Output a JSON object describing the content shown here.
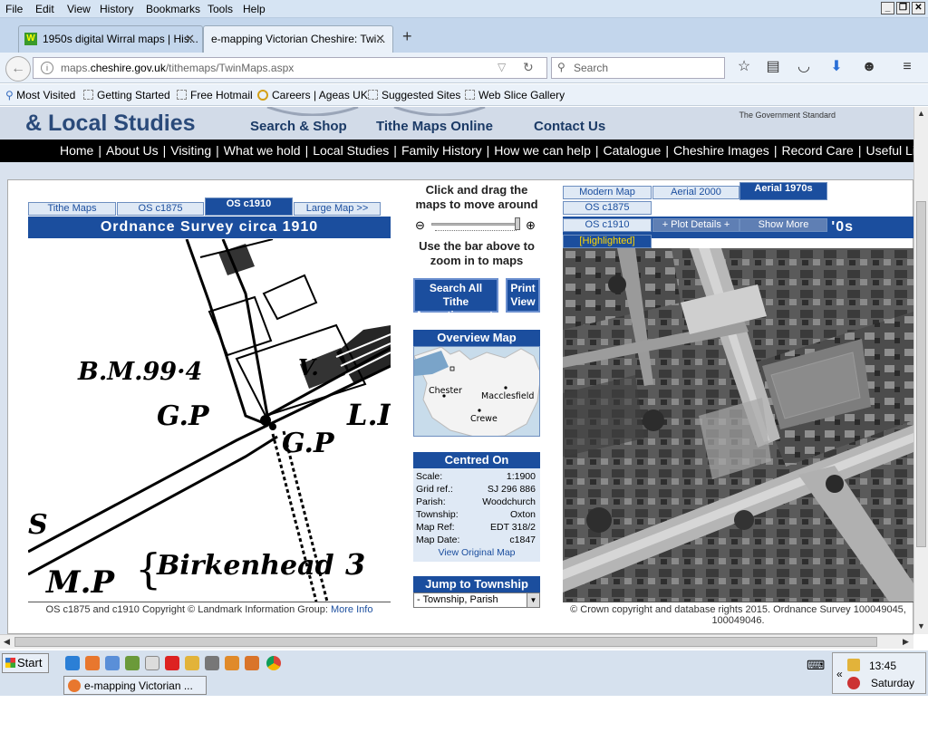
{
  "menu": [
    "File",
    "Edit",
    "View",
    "History",
    "Bookmarks",
    "Tools",
    "Help"
  ],
  "tabs": [
    {
      "label": "1950s digital Wirral maps | His..."
    },
    {
      "label": "e-mapping Victorian Cheshire: Twi..."
    }
  ],
  "url": {
    "prefix": "maps.",
    "domain": "cheshire.gov.uk",
    "path": "/tithemaps/TwinMaps.aspx"
  },
  "search_placeholder": "Search",
  "bookmarks": [
    "Most Visited",
    "Getting Started",
    "Free Hotmail",
    "Careers | Ageas UK",
    "Suggested Sites",
    "Web Slice Gallery"
  ],
  "site": {
    "title": "& Local Studies",
    "header_links": [
      "Search & Shop",
      "Tithe Maps Online",
      "Contact Us"
    ],
    "gov_standard": "The Government Standard",
    "nav": [
      "Home",
      "About Us",
      "Visiting",
      "What we hold",
      "Local Studies",
      "Family History",
      "How we can help",
      "Catalogue",
      "Cheshire Images",
      "Record Care",
      "Useful Links"
    ]
  },
  "left_map": {
    "tabs": [
      "Tithe Maps",
      "OS c1875",
      "OS c1910",
      "Large Map >>"
    ],
    "selected_tab": "OS c1910",
    "title": "Ordnance Survey circa 1910",
    "labels": [
      "B.M.99·4",
      "G.P",
      "G.P",
      "L.I",
      "V.",
      "S",
      "M.P",
      "Birkenhead",
      "3"
    ],
    "copyright": "OS c1875 and c1910 Copyright © Landmark Information Group:",
    "copyright_link": "More Info"
  },
  "middle": {
    "instruction1": "Click and drag the maps to move around",
    "instruction2": "Use the bar above to zoom in to maps",
    "search_tithe_button": "Search All Tithe Apportionments",
    "print_button": "Print View",
    "overview_title": "Overview Map",
    "overview_places": [
      "Chester",
      "Macclesfield",
      "Crewe"
    ],
    "centred_title": "Centred On",
    "centred": [
      {
        "k": "Scale:",
        "v": "1:1900"
      },
      {
        "k": "Grid ref.:",
        "v": "SJ 296 886"
      },
      {
        "k": "Parish:",
        "v": "Woodchurch"
      },
      {
        "k": "Township:",
        "v": "Oxton"
      },
      {
        "k": "Map Ref:",
        "v": "EDT 318/2"
      },
      {
        "k": "Map Date:",
        "v": "c1847"
      }
    ],
    "view_original": "View Original Map",
    "jump_title": "Jump to Township",
    "jump_value": "- Township, Parish"
  },
  "right_map": {
    "tabs_row1": [
      "Modern Map",
      "Aerial 2000",
      "Aerial 1970s"
    ],
    "tabs_row2": [
      "OS c1875"
    ],
    "tabs_row3": [
      "OS c1910",
      "+ Plot Details +",
      "Show More"
    ],
    "selected_tab": "Aerial 1970s",
    "title_fragment": "'0s",
    "highlighted": "[Highlighted]",
    "copyright": "© Crown copyright and database rights 2015. Ordnance Survey 100049045, 100049046."
  },
  "taskbar": {
    "start": "Start",
    "window": "e-mapping Victorian ...",
    "time": "13:45",
    "day": "Saturday"
  },
  "colors": {
    "accent": "#1b4e9e",
    "nav_bg": "#000000",
    "menubar": "#d6e4f3"
  }
}
